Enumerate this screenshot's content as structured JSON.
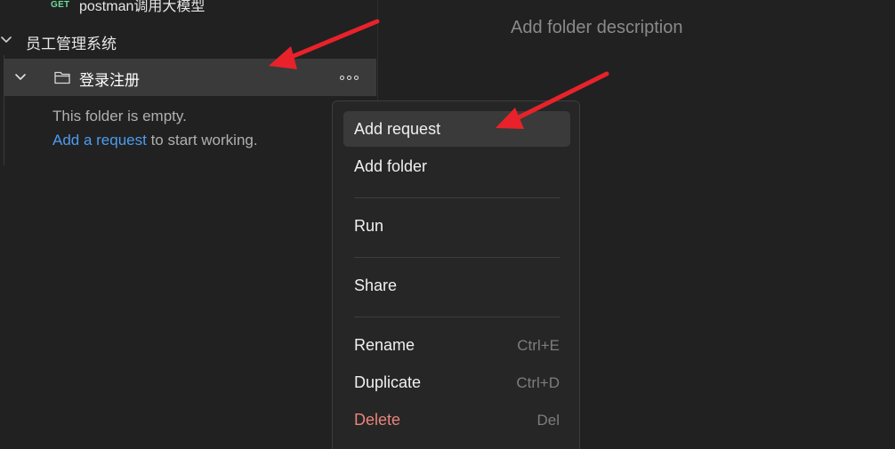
{
  "sidebar": {
    "request": {
      "method": "GET",
      "name": "postman调用大模型"
    },
    "collection": {
      "name": "员工管理系统"
    },
    "folder": {
      "name": "登录注册"
    },
    "empty_state": {
      "line1": "This folder is empty.",
      "link": "Add a request",
      "line2_rest": " to start working."
    }
  },
  "main": {
    "description_placeholder": "Add folder description"
  },
  "context_menu": {
    "items": [
      {
        "label": "Add request",
        "shortcut": ""
      },
      {
        "label": "Add folder",
        "shortcut": ""
      },
      {
        "label": "Run",
        "shortcut": ""
      },
      {
        "label": "Share",
        "shortcut": ""
      },
      {
        "label": "Rename",
        "shortcut": "Ctrl+E"
      },
      {
        "label": "Duplicate",
        "shortcut": "Ctrl+D"
      },
      {
        "label": "Delete",
        "shortcut": "Del"
      }
    ]
  },
  "colors": {
    "background": "#212121",
    "method_get": "#6bdd9a",
    "link": "#4d9cf0",
    "danger": "#e8847a",
    "annotation_arrow": "#e8222a"
  },
  "icons": {
    "collection_toggle": "chevron-down-icon",
    "folder_toggle": "chevron-down-icon",
    "folder": "folder-icon",
    "more": "more-horizontal-icon"
  }
}
